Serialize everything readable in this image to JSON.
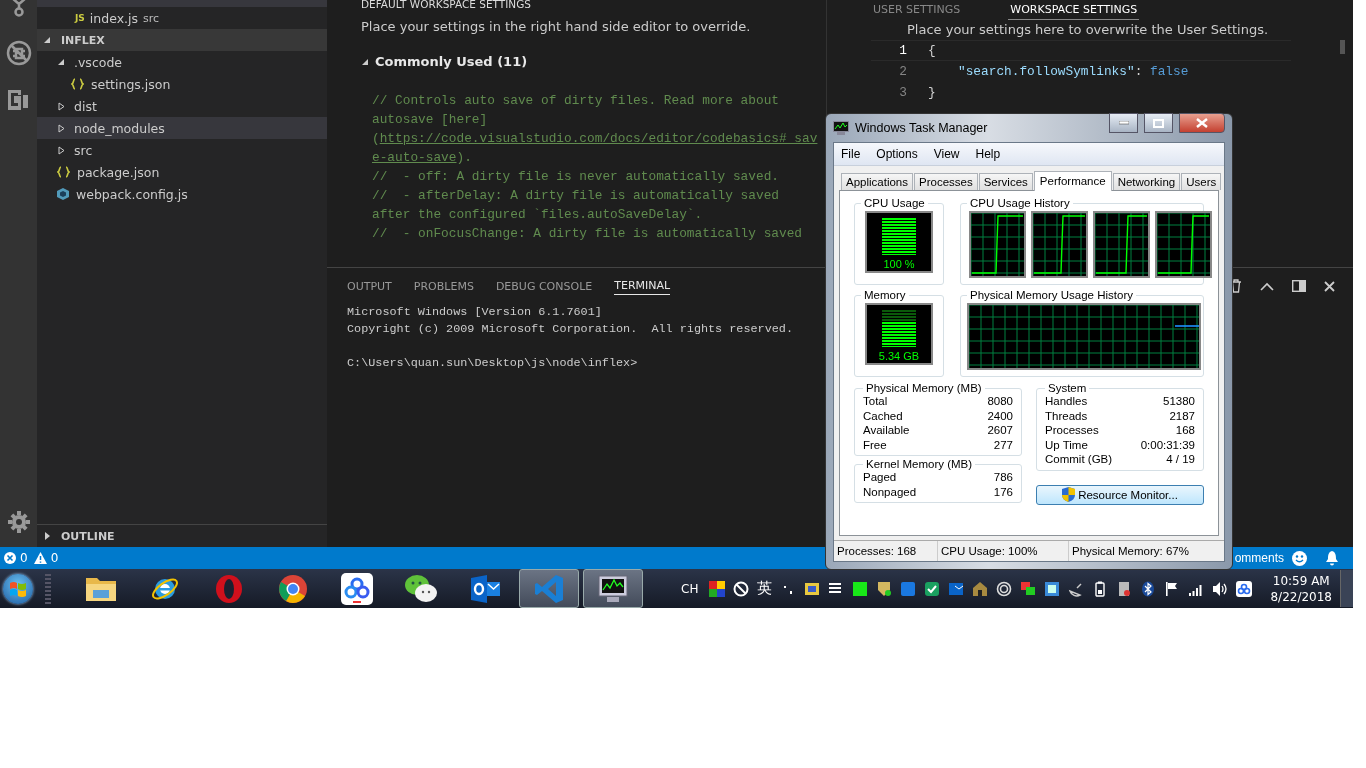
{
  "open_editors": [
    {
      "icon_text": "JS",
      "name": "index.js",
      "description": "src"
    }
  ],
  "explorer": {
    "title": "INFLEX",
    "expanded": true,
    "items": [
      {
        "name": ".vscode",
        "kind": "folder",
        "expanded": true,
        "selected": false,
        "children": [
          {
            "name": "settings.json",
            "kind": "json",
            "selected": false
          }
        ]
      },
      {
        "name": "dist",
        "kind": "folder",
        "expanded": false,
        "selected": false
      },
      {
        "name": "node_modules",
        "kind": "folder",
        "expanded": false,
        "selected": true
      },
      {
        "name": "src",
        "kind": "folder",
        "expanded": false,
        "selected": false
      },
      {
        "name": "package.json",
        "kind": "json",
        "selected": false
      },
      {
        "name": "webpack.config.js",
        "kind": "webpack",
        "selected": false
      }
    ]
  },
  "outline": {
    "title": "OUTLINE",
    "expanded": false
  },
  "default_settings": {
    "title": "DEFAULT WORKSPACE SETTINGS",
    "hint": "Place your settings in the right hand side editor to override.",
    "group": {
      "title": "Commonly Used (11)",
      "expanded": true
    },
    "lines": [
      [
        {
          "text": "// Controls auto save of dirty files. Read more about",
          "link": false
        }
      ],
      [
        {
          "text": "autosave [here]",
          "link": false
        }
      ],
      [
        {
          "text": "(",
          "link": false
        },
        {
          "text": "https://code.visualstudio.com/docs/editor/codebasics#_sav",
          "link": true
        }
      ],
      [
        {
          "text": "e-auto-save",
          "link": true
        },
        {
          "text": ").",
          "link": false
        }
      ],
      [
        {
          "text": "//  - off: A dirty file is never automatically saved.",
          "link": false
        }
      ],
      [
        {
          "text": "//  - afterDelay: A dirty file is automatically saved",
          "link": false
        }
      ],
      [
        {
          "text": "after the configured `files.autoSaveDelay`.",
          "link": false
        }
      ],
      [
        {
          "text": "//  - onFocusChange: A dirty file is automatically saved",
          "link": false
        }
      ]
    ]
  },
  "settings_editor": {
    "tabs": [
      {
        "label": "USER SETTINGS",
        "selected": false
      },
      {
        "label": "WORKSPACE SETTINGS",
        "selected": true
      }
    ],
    "hint": "Place your settings here to overwrite the User Settings.",
    "lines": [
      {
        "number": "1",
        "current": true,
        "tokens": [
          {
            "text": "{",
            "kind": "brace"
          }
        ]
      },
      {
        "number": "2",
        "current": false,
        "tokens": [
          {
            "text": "\"search.followSymlinks\"",
            "kind": "key"
          },
          {
            "text": ": ",
            "kind": "punct"
          },
          {
            "text": "false",
            "kind": "value"
          }
        ]
      },
      {
        "number": "3",
        "current": false,
        "tokens": [
          {
            "text": "}",
            "kind": "brace"
          }
        ]
      }
    ]
  },
  "panel": {
    "tabs": [
      {
        "label": "OUTPUT",
        "selected": false
      },
      {
        "label": "PROBLEMS",
        "selected": false
      },
      {
        "label": "DEBUG CONSOLE",
        "selected": false
      },
      {
        "label": "TERMINAL",
        "selected": true
      }
    ],
    "terminal": [
      {
        "text": "Microsoft Windows [Version 6.1.7601]",
        "kind": "output"
      },
      {
        "text": "Copyright (c) 2009 Microsoft Corporation.  All rights reserved.",
        "kind": "output"
      },
      {
        "text": "C:\\Users\\quan.sun\\Desktop\\js\\node\\inflex>",
        "kind": "prompt"
      }
    ]
  },
  "status_bar": {
    "errors": "0",
    "warnings": "0",
    "right_text": "omments"
  },
  "task_manager": {
    "title": "Windows Task Manager",
    "menu": [
      "File",
      "Options",
      "View",
      "Help"
    ],
    "tabs": [
      {
        "label": "Applications",
        "selected": false
      },
      {
        "label": "Processes",
        "selected": false
      },
      {
        "label": "Services",
        "selected": false
      },
      {
        "label": "Performance",
        "selected": true
      },
      {
        "label": "Networking",
        "selected": false
      },
      {
        "label": "Users",
        "selected": false
      }
    ],
    "cpu": {
      "title": "CPU Usage",
      "reading": "100 %",
      "level": 1.0
    },
    "cpu_history": {
      "title": "CPU Usage History"
    },
    "memory": {
      "title": "Memory",
      "reading": "5.34 GB",
      "level": 0.67
    },
    "memory_history": {
      "title": "Physical Memory Usage History"
    },
    "physical_memory": {
      "title": "Physical Memory (MB)",
      "rows": [
        {
          "label": "Total",
          "value": "8080"
        },
        {
          "label": "Cached",
          "value": "2400"
        },
        {
          "label": "Available",
          "value": "2607"
        },
        {
          "label": "Free",
          "value": "277"
        }
      ]
    },
    "kernel_memory": {
      "title": "Kernel Memory (MB)",
      "rows": [
        {
          "label": "Paged",
          "value": "786"
        },
        {
          "label": "Nonpaged",
          "value": "176"
        }
      ]
    },
    "system": {
      "title": "System",
      "rows": [
        {
          "label": "Handles",
          "value": "51380"
        },
        {
          "label": "Threads",
          "value": "2187"
        },
        {
          "label": "Processes",
          "value": "168"
        },
        {
          "label": "Up Time",
          "value": "0:00:31:39"
        },
        {
          "label": "Commit (GB)",
          "value": "4 / 19"
        }
      ]
    },
    "button": "Resource Monitor...",
    "status": [
      "Processes: 168",
      "CPU Usage: 100%",
      "Physical Memory: 67%"
    ]
  },
  "taskbar": {
    "apps": [
      {
        "kind": "explorer",
        "active": false
      },
      {
        "kind": "ie",
        "active": false
      },
      {
        "kind": "opera",
        "active": false
      },
      {
        "kind": "chrome",
        "active": false
      },
      {
        "kind": "baidu",
        "active": false
      },
      {
        "kind": "wechat",
        "active": false
      },
      {
        "kind": "outlook",
        "active": false
      },
      {
        "kind": "vscode",
        "active": true
      },
      {
        "kind": "taskmgr",
        "active": true
      }
    ],
    "language": "CH",
    "ime_mode": "英",
    "time": "10:59 AM",
    "date": "8/22/2018"
  }
}
